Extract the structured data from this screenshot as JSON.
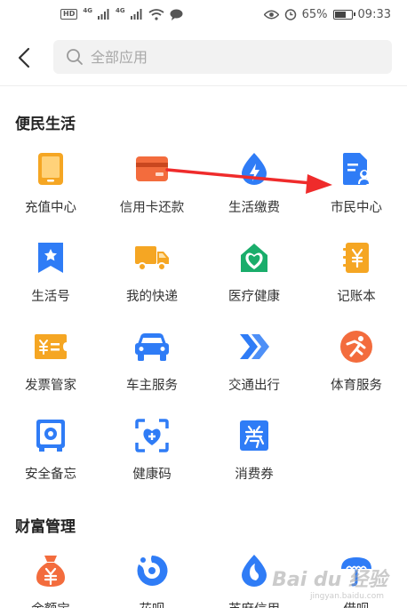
{
  "status_bar": {
    "hd": "HD",
    "net1": "4G",
    "net2": "4G",
    "battery_percent": "65%",
    "time": "09:33"
  },
  "header": {
    "search_placeholder": "全部应用"
  },
  "sections": [
    {
      "title": "便民生活",
      "items": [
        {
          "label": "充值中心",
          "icon": "phone-icon",
          "color": "#f5a623"
        },
        {
          "label": "信用卡还款",
          "icon": "credit-card-icon",
          "color": "#f36c3d"
        },
        {
          "label": "生活缴费",
          "icon": "lightning-drop-icon",
          "color": "#2f7cf6"
        },
        {
          "label": "市民中心",
          "icon": "citizen-doc-icon",
          "color": "#2f7cf6"
        },
        {
          "label": "生活号",
          "icon": "bookmark-star-icon",
          "color": "#2f7cf6"
        },
        {
          "label": "我的快递",
          "icon": "truck-icon",
          "color": "#f5a623"
        },
        {
          "label": "医疗健康",
          "icon": "heart-cross-icon",
          "color": "#1aad6b"
        },
        {
          "label": "记账本",
          "icon": "yuan-notebook-icon",
          "color": "#f5a623"
        },
        {
          "label": "发票管家",
          "icon": "invoice-icon",
          "color": "#f5a623"
        },
        {
          "label": "车主服务",
          "icon": "car-icon",
          "color": "#2f7cf6"
        },
        {
          "label": "交通出行",
          "icon": "double-chevron-icon",
          "color": "#2f7cf6"
        },
        {
          "label": "体育服务",
          "icon": "runner-icon",
          "color": "#f36c3d"
        },
        {
          "label": "安全备忘",
          "icon": "safe-icon",
          "color": "#2f7cf6"
        },
        {
          "label": "健康码",
          "icon": "health-code-icon",
          "color": "#2f7cf6"
        },
        {
          "label": "消费券",
          "icon": "coupon-icon",
          "color": "#2f7cf6"
        }
      ]
    },
    {
      "title": "财富管理",
      "items": [
        {
          "label": "余额宝",
          "icon": "money-bag-icon",
          "color": "#f36c3d"
        },
        {
          "label": "花呗",
          "icon": "huabei-icon",
          "color": "#2f7cf6"
        },
        {
          "label": "芝麻信用",
          "icon": "sesame-icon",
          "color": "#2f7cf6"
        },
        {
          "label": "借呗",
          "icon": "jiebei-icon",
          "color": "#2f7cf6"
        }
      ]
    }
  ],
  "watermark": {
    "text": "Bai du 经验",
    "sub": "jingyan.baidu.com"
  }
}
